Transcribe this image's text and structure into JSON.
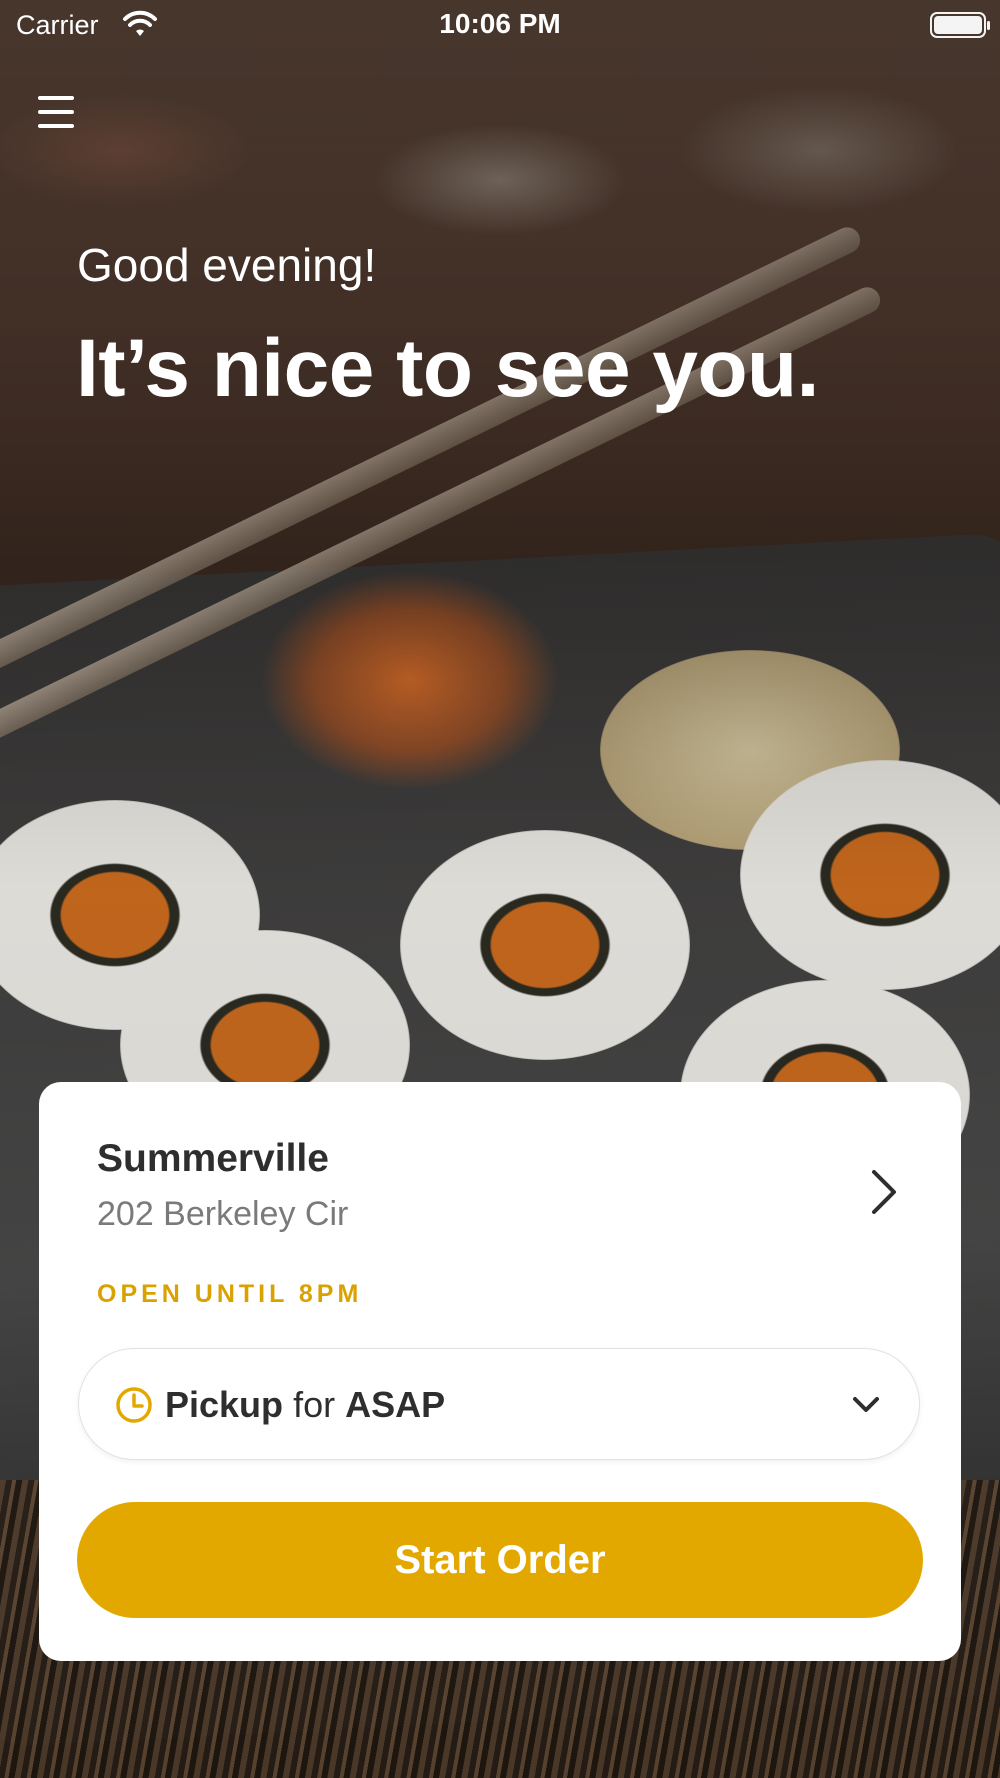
{
  "status_bar": {
    "carrier": "Carrier",
    "time": "10:06 PM"
  },
  "header": {
    "menu_icon": "hamburger-menu-icon",
    "greeting": "Good evening!",
    "headline": "It’s nice to see you."
  },
  "card": {
    "store_name": "Summerville",
    "store_address": "202 Berkeley Cir",
    "open_status": "OPEN UNTIL 8PM",
    "pickup": {
      "mode": "Pickup",
      "connector": "for",
      "time": "ASAP"
    },
    "start_button_label": "Start Order"
  },
  "icons": {
    "wifi": "wifi-icon",
    "battery": "battery-icon",
    "chevron_right": "chevron-right-icon",
    "clock": "clock-icon",
    "chevron_down": "chevron-down-icon"
  },
  "colors": {
    "accent": "#e3a800",
    "accent_text": "#d9a200",
    "card_bg": "#ffffff",
    "text_dark": "#2e2e2e",
    "text_muted": "#7a7a7a"
  }
}
